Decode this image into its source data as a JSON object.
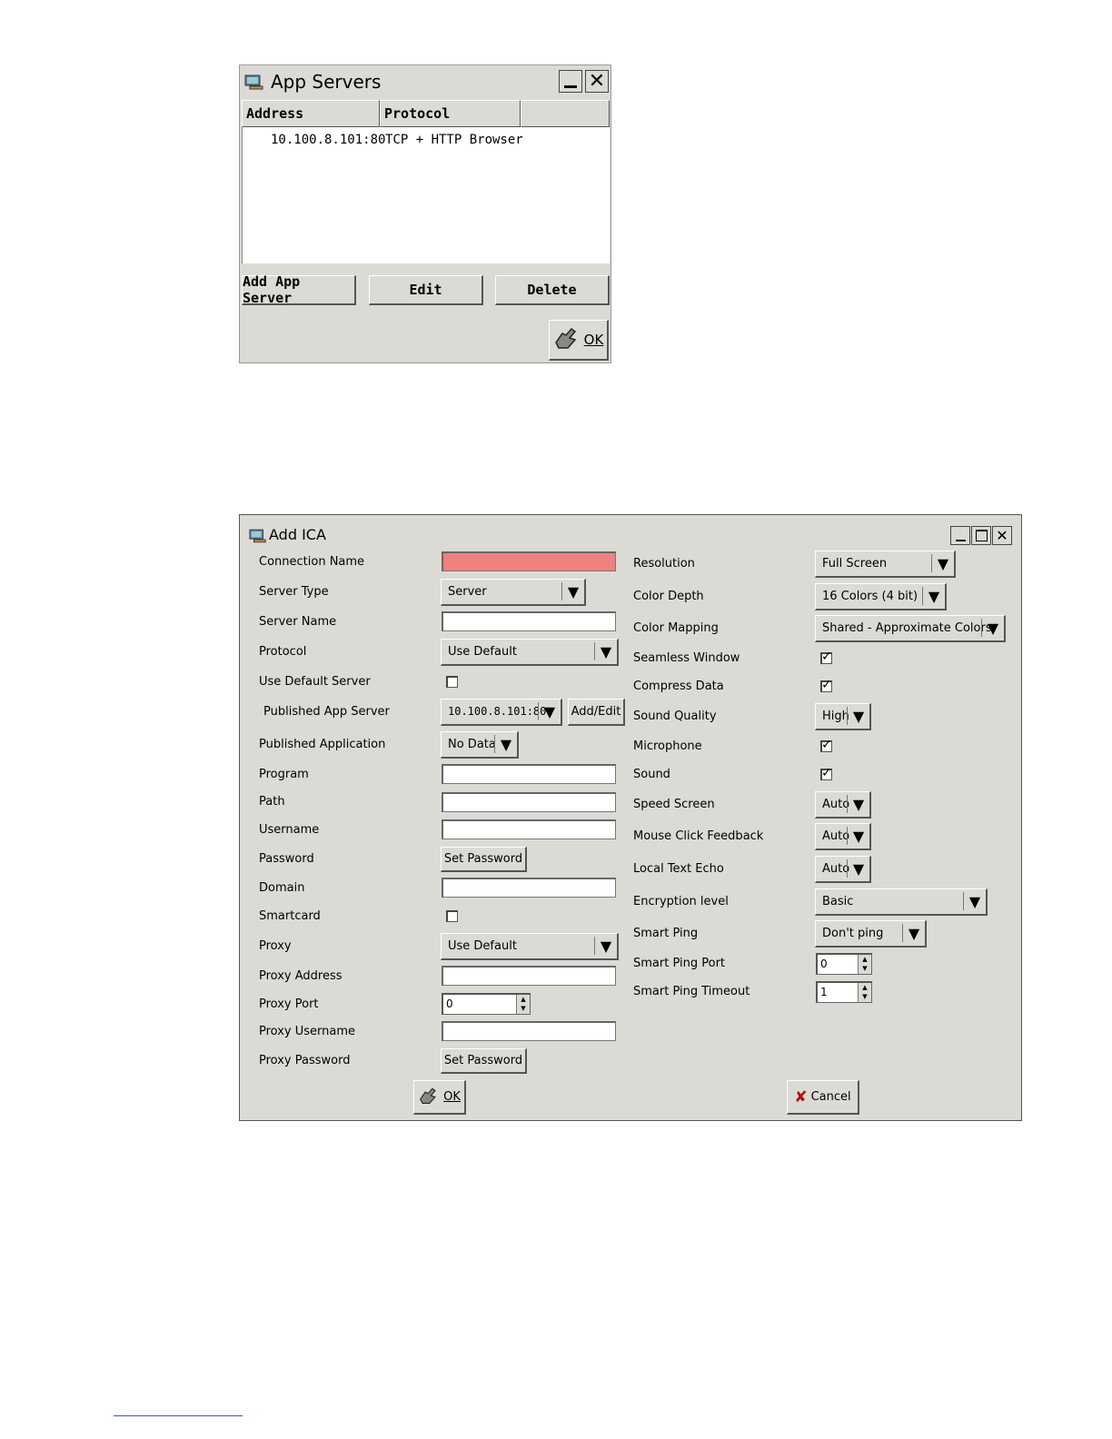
{
  "app_servers": {
    "title": "App Servers",
    "columns": [
      "Address",
      "Protocol",
      ""
    ],
    "rows": [
      {
        "address": "10.100.8.101:80",
        "protocol": "TCP + HTTP Browser"
      }
    ],
    "buttons": {
      "add": "Add App Server",
      "edit": "Edit",
      "delete": "Delete",
      "ok": "OK"
    }
  },
  "add_ica": {
    "title": "Add ICA",
    "left": {
      "connection_name": {
        "label": "Connection Name",
        "value": ""
      },
      "server_type": {
        "label": "Server Type",
        "value": "Server"
      },
      "server_name": {
        "label": "Server Name",
        "value": ""
      },
      "protocol": {
        "label": "Protocol",
        "value": "Use Default"
      },
      "use_default_server": {
        "label": "Use Default Server",
        "checked": false
      },
      "published_app_server": {
        "label": "Published App Server",
        "value": "10.100.8.101:80",
        "button": "Add/Edit"
      },
      "published_application": {
        "label": "Published Application",
        "value": "No Data"
      },
      "program": {
        "label": "Program",
        "value": ""
      },
      "path": {
        "label": "Path",
        "value": ""
      },
      "username": {
        "label": "Username",
        "value": ""
      },
      "password": {
        "label": "Password",
        "button": "Set Password"
      },
      "domain": {
        "label": "Domain",
        "value": ""
      },
      "smartcard": {
        "label": "Smartcard",
        "checked": false
      },
      "proxy": {
        "label": "Proxy",
        "value": "Use Default"
      },
      "proxy_address": {
        "label": "Proxy Address",
        "value": ""
      },
      "proxy_port": {
        "label": "Proxy Port",
        "value": "0"
      },
      "proxy_username": {
        "label": "Proxy Username",
        "value": ""
      },
      "proxy_password": {
        "label": "Proxy Password",
        "button": "Set Password"
      }
    },
    "right": {
      "resolution": {
        "label": "Resolution",
        "value": "Full Screen"
      },
      "color_depth": {
        "label": "Color Depth",
        "value": "16 Colors (4 bit)"
      },
      "color_mapping": {
        "label": "Color Mapping",
        "value": "Shared - Approximate Colors"
      },
      "seamless_window": {
        "label": "Seamless Window",
        "checked": true
      },
      "compress_data": {
        "label": "Compress Data",
        "checked": true
      },
      "sound_quality": {
        "label": "Sound Quality",
        "value": "High"
      },
      "microphone": {
        "label": "Microphone",
        "checked": true
      },
      "sound": {
        "label": "Sound",
        "checked": true
      },
      "speed_screen": {
        "label": "Speed Screen",
        "value": "Auto"
      },
      "mouse_click_feedback": {
        "label": "Mouse Click Feedback",
        "value": "Auto"
      },
      "local_text_echo": {
        "label": "Local Text Echo",
        "value": "Auto"
      },
      "encryption_level": {
        "label": "Encryption level",
        "value": "Basic"
      },
      "smart_ping": {
        "label": "Smart Ping",
        "value": "Don't ping"
      },
      "smart_ping_port": {
        "label": "Smart Ping Port",
        "value": "0"
      },
      "smart_ping_timeout": {
        "label": "Smart Ping Timeout",
        "value": "1"
      }
    },
    "buttons": {
      "ok": "OK",
      "cancel": "Cancel"
    }
  },
  "icons": [
    "app-icon",
    "minimize-icon",
    "maximize-icon",
    "close-icon",
    "ok-hand-icon",
    "cancel-x-icon",
    "dropdown-arrow-icon",
    "check-icon"
  ],
  "colors": {
    "window_bg": "#dcdad5",
    "required_field": "#f08080"
  }
}
